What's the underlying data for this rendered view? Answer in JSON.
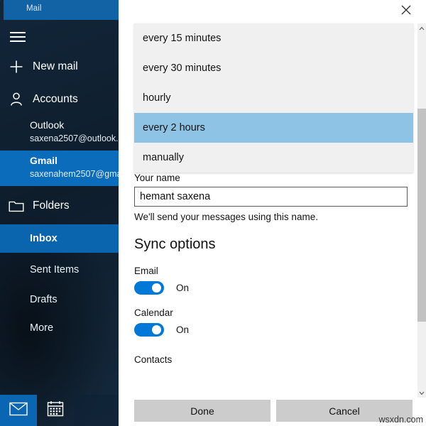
{
  "window": {
    "app_title": "Mail",
    "close_icon": "close-icon"
  },
  "sidebar": {
    "menu_icon": "hamburger-menu-icon",
    "primary_items": [
      {
        "label": "New mail",
        "icon": "plus-icon"
      },
      {
        "label": "Accounts",
        "icon": "person-icon"
      }
    ],
    "accounts": [
      {
        "name": "Outlook",
        "email": "saxena2507@outlook.",
        "selected": false
      },
      {
        "name": "Gmail",
        "email": "saxenahem2507@gma",
        "selected": true
      }
    ],
    "folders_header": {
      "label": "Folders",
      "icon": "folder-icon"
    },
    "folders": [
      {
        "label": "Inbox",
        "selected": true
      },
      {
        "label": "Sent Items",
        "selected": false
      },
      {
        "label": "Drafts",
        "selected": false
      },
      {
        "label": "More",
        "selected": false
      }
    ],
    "bottom_bar": [
      {
        "icon": "mail-icon",
        "active": true
      },
      {
        "icon": "calendar-icon",
        "active": false
      }
    ],
    "accent_selected": "#0a6cba",
    "accent_folder_selected": "#0a64ae",
    "titlebar_color": "#1263a6"
  },
  "settings": {
    "dropdown": {
      "name": "sync-frequency-dropdown",
      "options": [
        {
          "label": "every 15 minutes",
          "selected": false
        },
        {
          "label": "every 30 minutes",
          "selected": false
        },
        {
          "label": "hourly",
          "selected": false
        },
        {
          "label": "every 2 hours",
          "selected": true
        },
        {
          "label": "manually",
          "selected": false
        }
      ],
      "highlight_color": "#8ec3e6"
    },
    "your_name": {
      "label": "Your name",
      "value": "hemant saxena",
      "placeholder": "Your name",
      "helper": "We'll send your messages using this name."
    },
    "sync_options": {
      "title": "Sync options",
      "toggles": [
        {
          "label": "Email",
          "state": "On",
          "on": true
        },
        {
          "label": "Calendar",
          "state": "On",
          "on": true
        }
      ],
      "contacts_label": "Contacts",
      "toggle_on_color": "#0078d7"
    },
    "buttons": {
      "done": "Done",
      "cancel": "Cancel"
    },
    "scrollbar": {
      "up_arrow": "chevron-up-icon",
      "down_arrow": "chevron-down-icon"
    }
  },
  "watermark": "wsxdn.com"
}
